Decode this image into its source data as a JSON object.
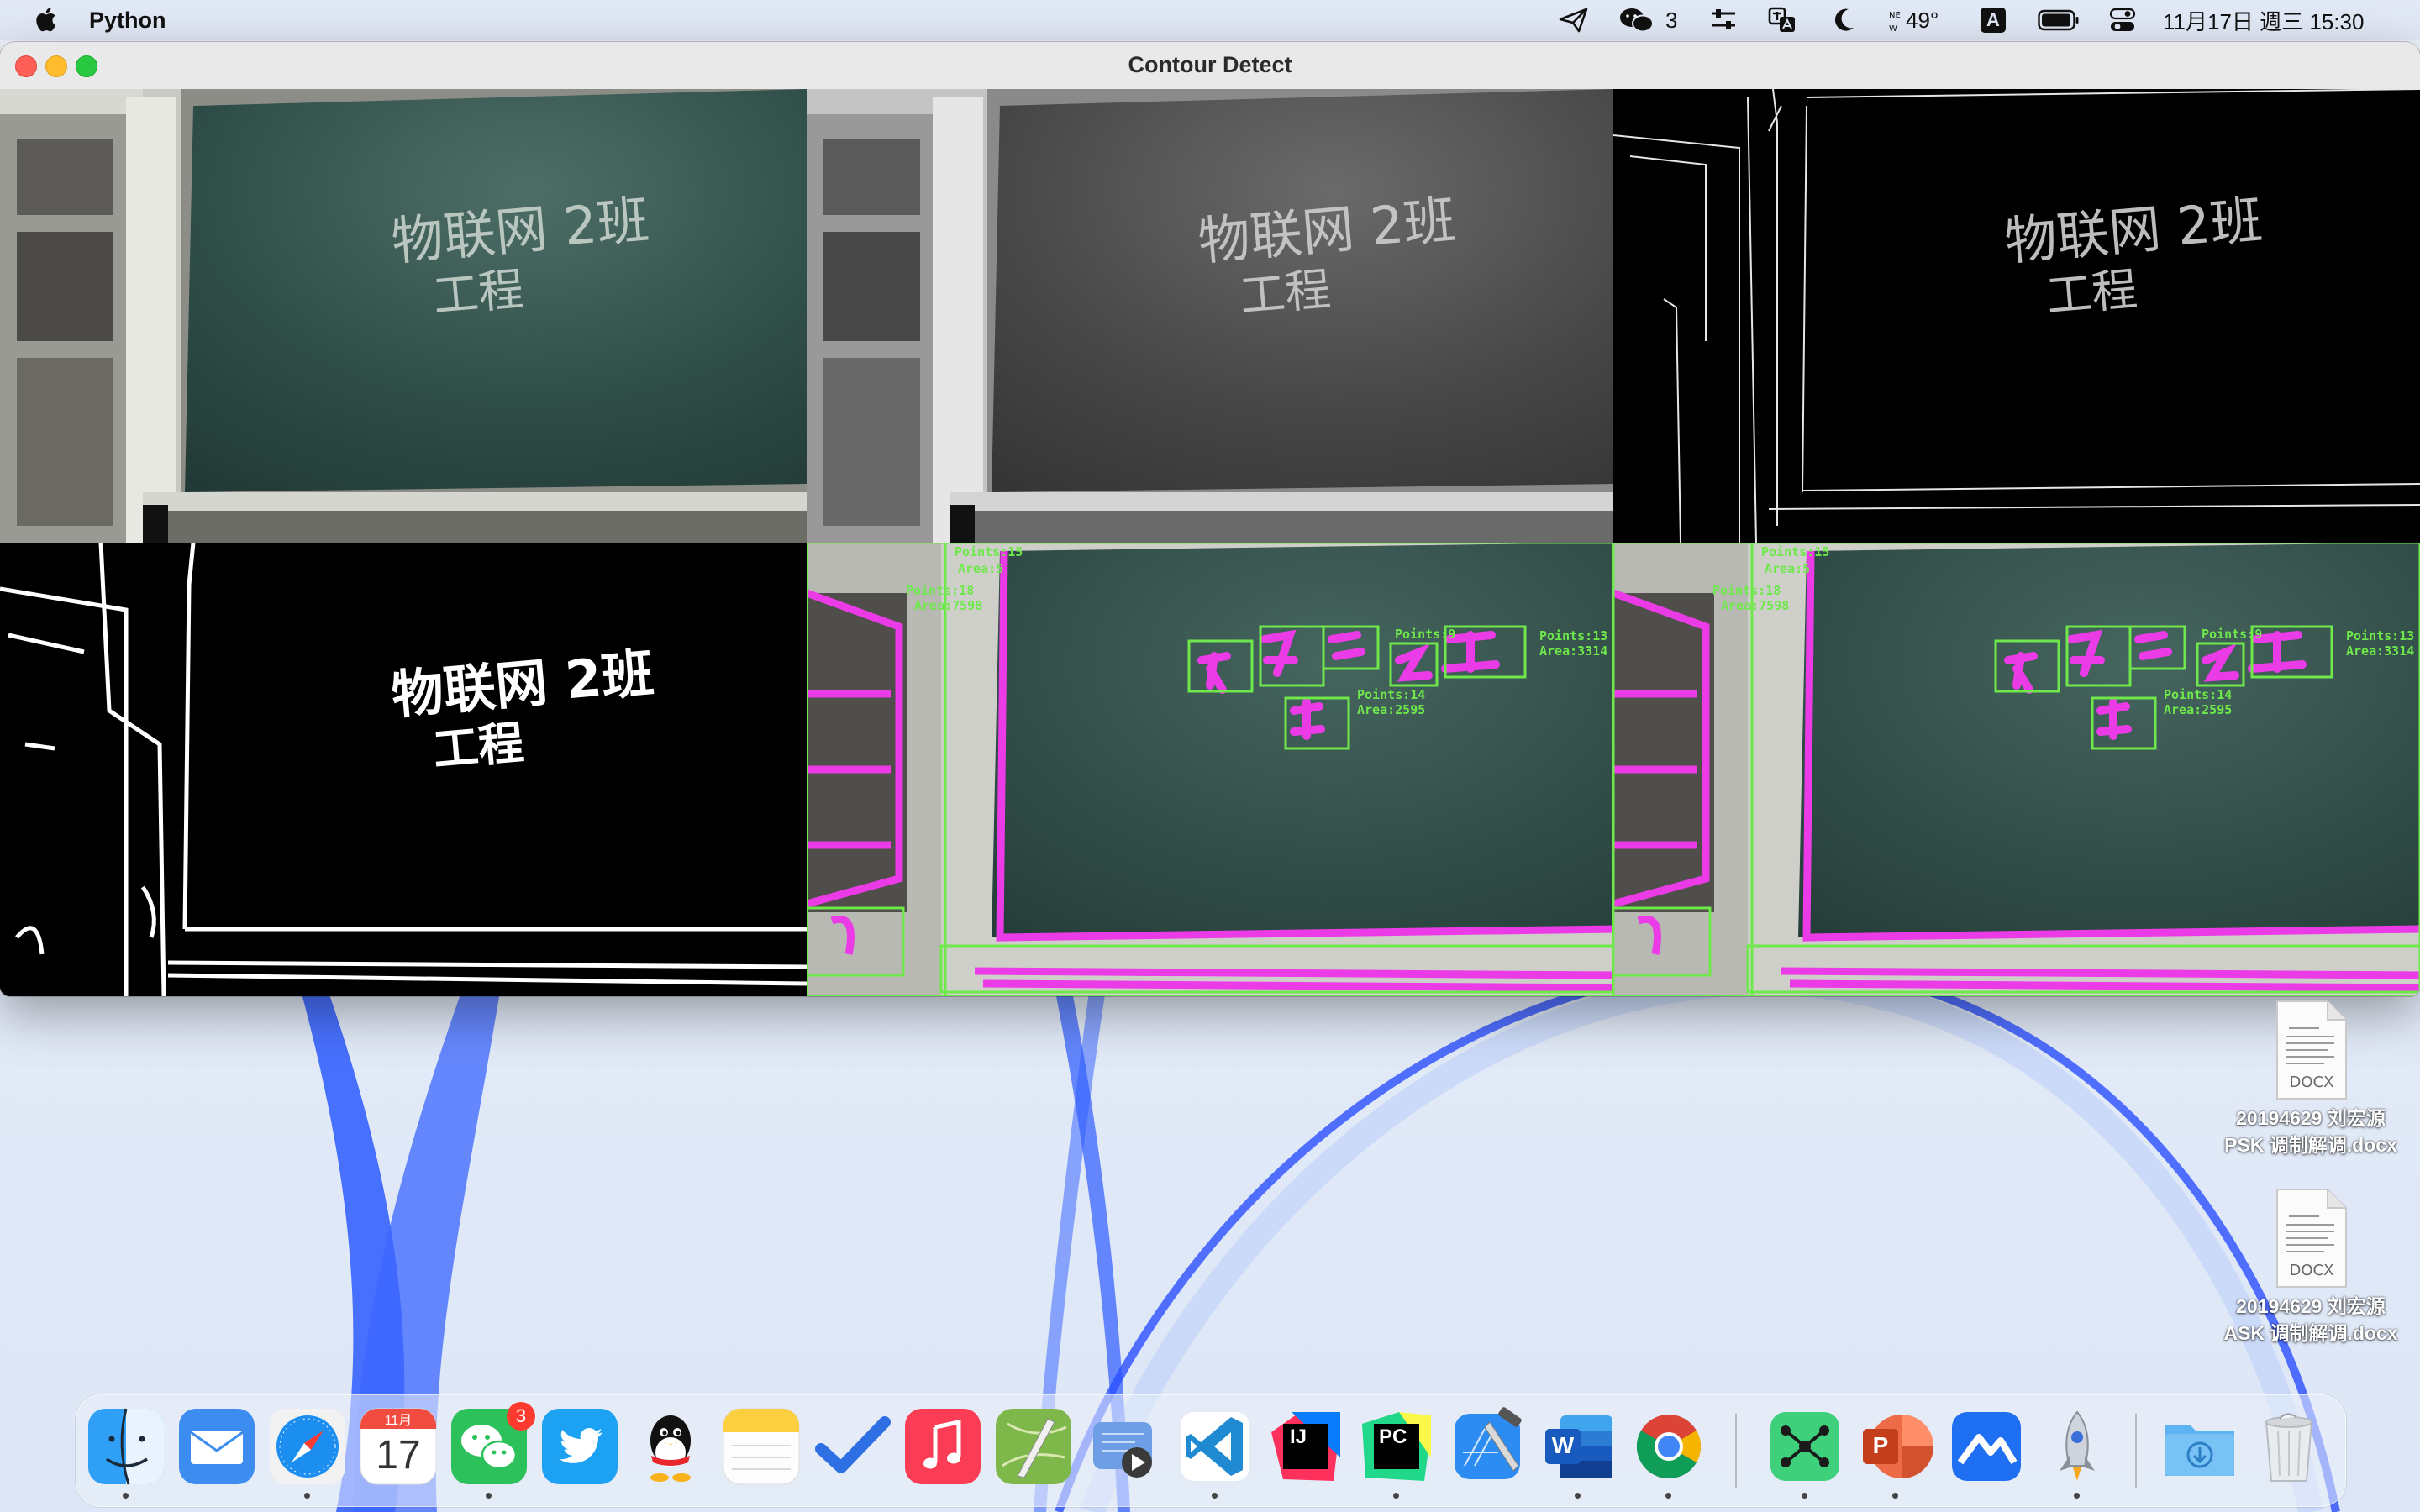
{
  "menubar": {
    "app_name": "Python",
    "wechat_count": "3",
    "temperature": "49°",
    "input_method": "A",
    "datetime": "11月17日 週三 15:30"
  },
  "window": {
    "title": "Contour Detect",
    "panels": [
      {
        "name": "original",
        "handwriting_line1": "物联网 2班",
        "handwriting_line2": "工程"
      },
      {
        "name": "grayscale",
        "handwriting_line1": "物联网 2班",
        "handwriting_line2": "工程"
      },
      {
        "name": "edges",
        "handwriting_line1": "物联网 2班",
        "handwriting_line2": "工程"
      },
      {
        "name": "dilated",
        "handwriting_line1": "物联网 2班",
        "handwriting_line2": "工程"
      },
      {
        "name": "contours",
        "labels": [
          "Points:15",
          "Area:5",
          "Points:18",
          "Area:7598",
          "Points:13",
          "Area:3314",
          "Points:14",
          "Area:2595",
          "Points:9"
        ]
      },
      {
        "name": "contours-copy",
        "labels": [
          "Points:15",
          "Area:5",
          "Points:18",
          "Area:7598",
          "Points:13",
          "Area:3314",
          "Points:14",
          "Area:2595",
          "Points:9"
        ]
      }
    ]
  },
  "desktop_files": [
    {
      "name_line1": "20194629 刘宏源",
      "name_line2": "PSK 调制解调.docx",
      "ext": "DOCX"
    },
    {
      "name_line1": "20194629 刘宏源",
      "name_line2": "ASK 调制解调.docx",
      "ext": "DOCX"
    }
  ],
  "dock": {
    "calendar_month": "11月",
    "calendar_day": "17",
    "wechat_badge": "3",
    "items": [
      "Finder",
      "Mail",
      "Safari",
      "Calendar",
      "WeChat",
      "Twitter",
      "QQ",
      "Notes",
      "Tasks",
      "Music",
      "Script Editor",
      "Keynote Player",
      "Visual Studio Code",
      "IntelliJ IDEA",
      "PyCharm",
      "Xcode",
      "Microsoft Word",
      "Google Chrome",
      "XMind",
      "Microsoft PowerPoint",
      "Lark",
      "Rocket",
      "Downloads",
      "Trash"
    ],
    "word_letter": "W",
    "ppt_letter": "P",
    "ij_letter": "IJ",
    "pc_letter": "PC"
  }
}
